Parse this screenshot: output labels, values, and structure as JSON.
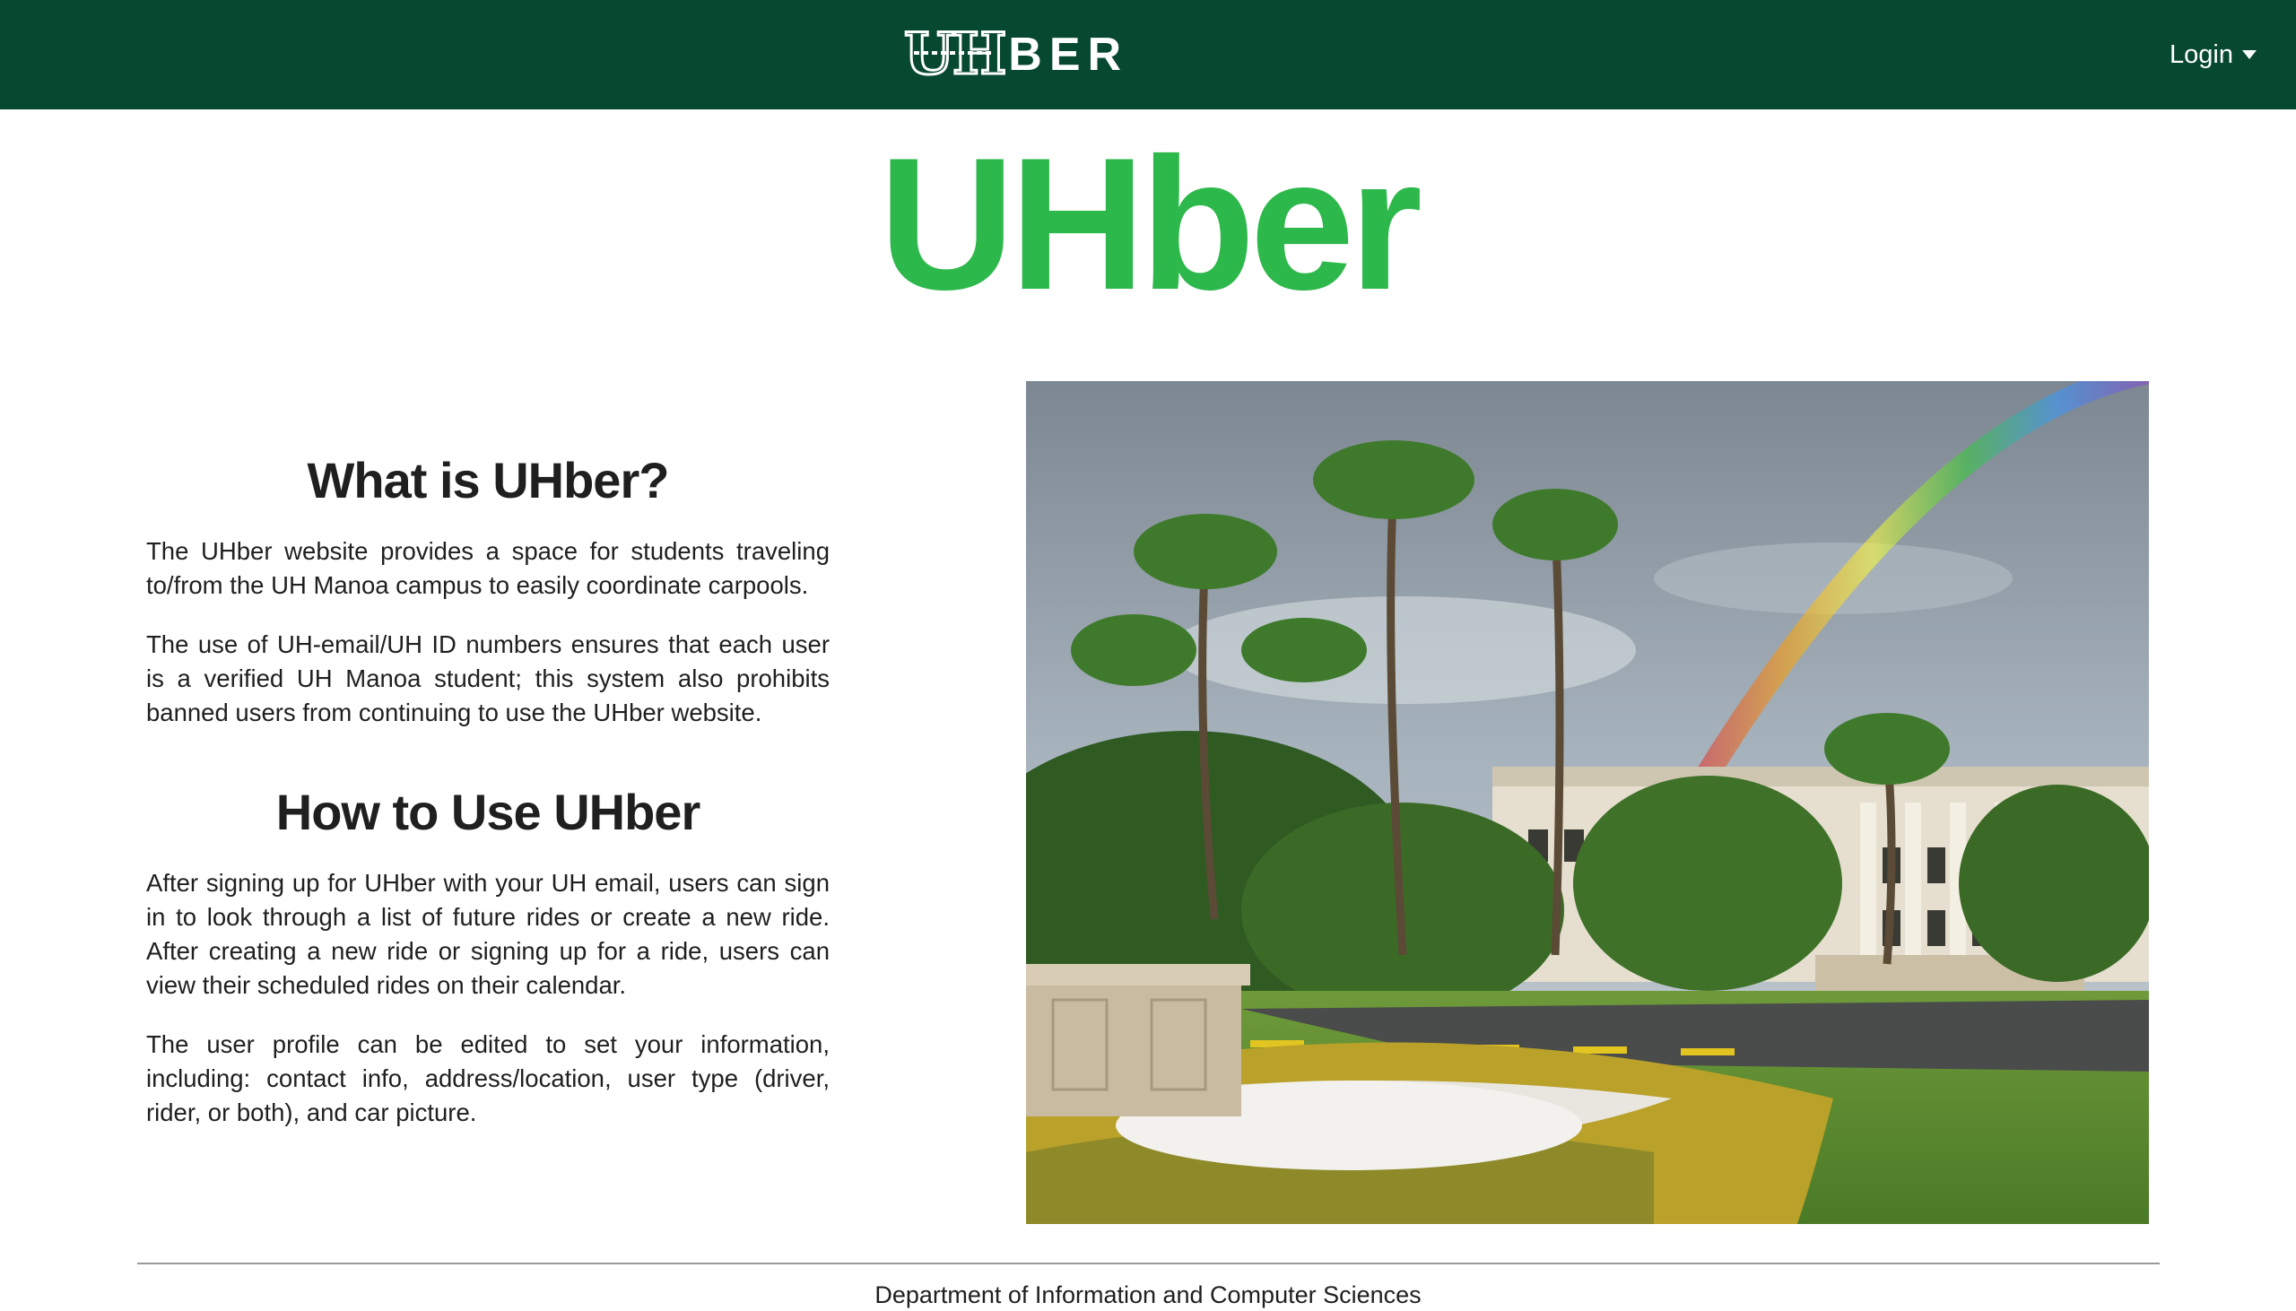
{
  "navbar": {
    "brand_mark": "UH",
    "brand_text": "BER",
    "login_label": "Login",
    "background_color": "#074830",
    "login_icon": "caret-down-icon"
  },
  "hero": {
    "title": "UHber",
    "title_color": "#2db84b"
  },
  "about": {
    "heading": "What is UHber?",
    "paragraphs": [
      "The UHber website provides a space for students traveling to/from the UH Manoa campus to easily coordinate carpools.",
      "The use of UH-email/UH ID numbers ensures that each user is a verified UH Manoa student; this system also prohibits banned users from continuing to use the UHber website."
    ]
  },
  "howto": {
    "heading": "How to Use UHber",
    "paragraphs": [
      "After signing up for UHber with your UH email, users can sign in to look through a list of future rides or create a new ride. After creating a new ride or signing up for a ride, users can view their scheduled rides on their calendar.",
      "The user profile can be edited to set your information, including: contact info, address/location, user type (driver, rider, or both), and car picture."
    ]
  },
  "photo": {
    "subject": "campus-photo-rainbow-palm-trees"
  },
  "footer": {
    "text": "Department of Information and Computer Sciences"
  }
}
